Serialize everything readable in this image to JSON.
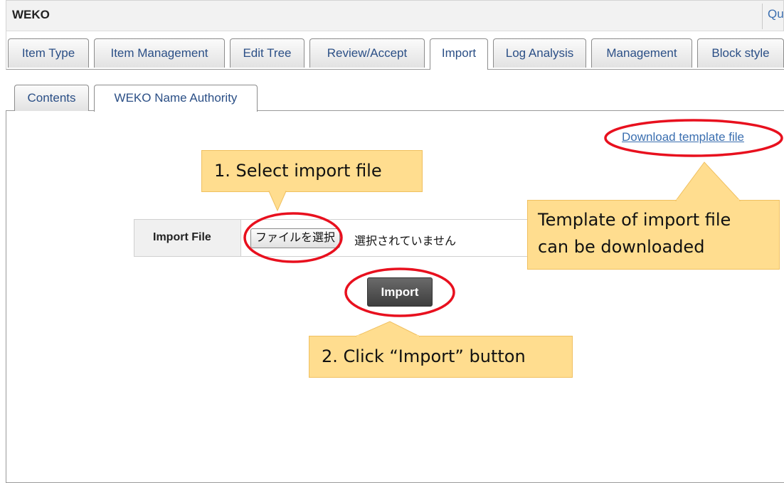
{
  "titlebar": {
    "title": "WEKO",
    "quit": "Quit"
  },
  "main_tabs": [
    {
      "label": "Item Type"
    },
    {
      "label": "Item Management"
    },
    {
      "label": "Edit Tree"
    },
    {
      "label": "Review/Accept"
    },
    {
      "label": "Import"
    },
    {
      "label": "Log Analysis"
    },
    {
      "label": "Management"
    },
    {
      "label": "Block style"
    }
  ],
  "sub_tabs": [
    {
      "label": "Contents"
    },
    {
      "label": "WEKO Name Authority"
    }
  ],
  "template_link": "Download template file",
  "import_form": {
    "label": "Import File",
    "file_button": "ファイルを選択",
    "file_status": "選択されていません",
    "import_button": "Import"
  },
  "callouts": {
    "step1": "1. Select import file",
    "template_line1": "Template of import file",
    "template_line2": "can be downloaded",
    "step2": "2. Click “Import” button"
  },
  "colors": {
    "callout_fill": "#ffdd8f",
    "highlight_ellipse": "#e8101e",
    "link": "#3b6fb0"
  }
}
